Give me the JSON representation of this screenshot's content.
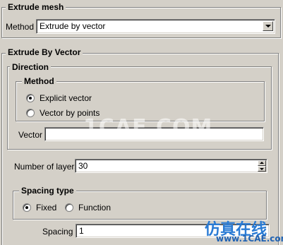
{
  "extrude_mesh": {
    "title": "Extrude mesh",
    "method_label": "Method",
    "method_value": "Extrude by vector"
  },
  "by_vector": {
    "title": "Extrude By Vector",
    "direction": {
      "title": "Direction",
      "method_title": "Method",
      "options": [
        "Explicit vector",
        "Vector by points"
      ],
      "selected": "Explicit vector",
      "vector_label": "Vector",
      "vector_value": ""
    },
    "layers_label": "Number of layers",
    "layers_value": "30",
    "spacing_type": {
      "title": "Spacing type",
      "options": [
        "Fixed",
        "Function"
      ],
      "selected": "Fixed"
    },
    "spacing_label": "Spacing",
    "spacing_value": "1"
  },
  "watermark": {
    "center_text": "1CAE.COM",
    "brand_cn": "仿真在线",
    "brand_url": "www.1CAE.com"
  },
  "icons": [
    "dropdown-arrow-icon",
    "spinner-up-icon",
    "spinner-down-icon"
  ]
}
